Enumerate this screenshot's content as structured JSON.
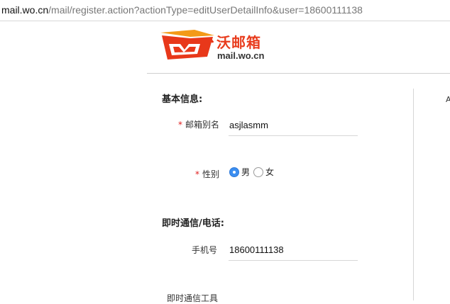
{
  "browser": {
    "url_host": "mail.wo.cn",
    "url_path": "/mail/register.action?actionType=editUserDetailInfo&user=18600111138"
  },
  "logo": {
    "name": "沃邮箱",
    "domain": "mail.wo.cn",
    "brand_color": "#e83b1c"
  },
  "form": {
    "sections": {
      "basic_title": "基本信息:",
      "im_title": "即时通信/电话:"
    },
    "required_mark": "*",
    "alias": {
      "label": "邮箱别名",
      "value": "asjlasmm"
    },
    "gender": {
      "label": "性别",
      "options": [
        {
          "label": "男",
          "selected": true
        },
        {
          "label": "女",
          "selected": false
        }
      ]
    },
    "phone": {
      "label": "手机号",
      "value": "18600111138"
    },
    "im_tool": {
      "label": "即时通信工具"
    }
  },
  "right_panel": {
    "mark": "A"
  },
  "colors": {
    "accent": "#3b8ef0",
    "required": "#e02020"
  }
}
